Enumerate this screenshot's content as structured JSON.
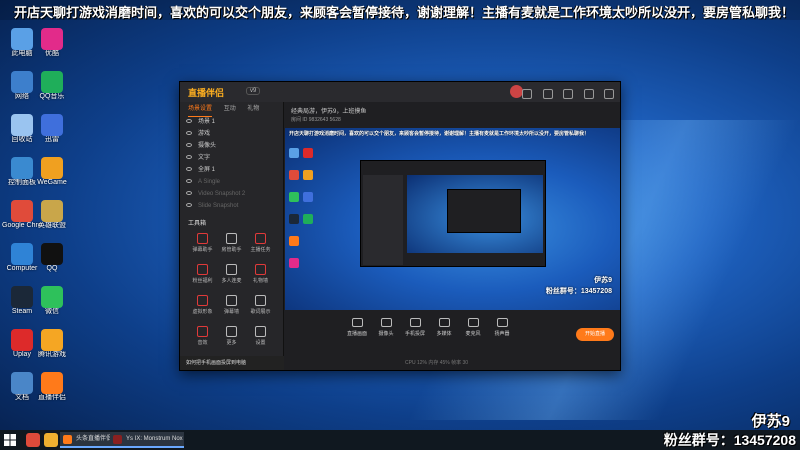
{
  "marquee": "开店天聊打游戏消磨时间，喜欢的可以交个朋友，来顾客会暂停接待，谢谢理解！主播有麦就是工作环境太吵所以没开，要房管私聊我！",
  "desktop_icons": [
    {
      "label": "此电脑",
      "color": "#5aa0e6"
    },
    {
      "label": "网络",
      "color": "#3d7fcc"
    },
    {
      "label": "回收站",
      "color": "#9ac4f0"
    },
    {
      "label": "控制面板",
      "color": "#3a8ad0"
    },
    {
      "label": "Google Chrome",
      "color": "#e04b3a"
    },
    {
      "label": "Computer",
      "color": "#2f83d6"
    },
    {
      "label": "Steam",
      "color": "#1b2838"
    },
    {
      "label": "Uplay",
      "color": "#dd2a2a"
    },
    {
      "label": "文档",
      "color": "#4a86c8"
    },
    {
      "label": "优酷",
      "color": "#e22b8a"
    },
    {
      "label": "QQ音乐",
      "color": "#1fae5a"
    },
    {
      "label": "迅雷",
      "color": "#3f6fdc"
    },
    {
      "label": "WeGame",
      "color": "#f0a020"
    },
    {
      "label": "英雄联盟",
      "color": "#c9a64a"
    },
    {
      "label": "QQ",
      "color": "#111111"
    },
    {
      "label": "微信",
      "color": "#2ec15b"
    },
    {
      "label": "腾讯游戏",
      "color": "#f5a623"
    },
    {
      "label": "直播伴侣",
      "color": "#ff7a1a"
    }
  ],
  "window": {
    "app_name": "直播伴侣",
    "version_badge": "v9",
    "left_tabs": [
      "场景设置",
      "互动",
      "礼物"
    ],
    "scenes": [
      {
        "name": "场景 1",
        "dim": false
      },
      {
        "name": "游戏",
        "dim": false
      },
      {
        "name": "摄像头",
        "dim": false
      },
      {
        "name": "文字",
        "dim": false
      },
      {
        "name": "全屏 1",
        "dim": false
      },
      {
        "name": "A Single",
        "dim": true
      },
      {
        "name": "Video Snapshot 2",
        "dim": true
      },
      {
        "name": "Slide Snapshot",
        "dim": true
      }
    ],
    "tools_title": "工具箱",
    "tools": [
      {
        "label": "弹幕助手",
        "color": "#e03a3a"
      },
      {
        "label": "房管助手",
        "color": "#bbbbbb"
      },
      {
        "label": "主播任务",
        "color": "#e03a3a"
      },
      {
        "label": "粉丝福利",
        "color": "#e03a3a"
      },
      {
        "label": "多人连麦",
        "color": "#bbbbbb"
      },
      {
        "label": "礼物墙",
        "color": "#e03a3a"
      },
      {
        "label": "虚拟形象",
        "color": "#e03a3a"
      },
      {
        "label": "弹幕墙",
        "color": "#bbbbbb"
      },
      {
        "label": "歌词展示",
        "color": "#bbbbbb"
      },
      {
        "label": "音效",
        "color": "#e03a3a"
      },
      {
        "label": "更多",
        "color": "#bbbbbb"
      },
      {
        "label": "设置",
        "color": "#bbbbbb"
      }
    ],
    "footer_tip": "如何把手机画面投屏到电脑",
    "stream_info": "经典局游，伊苏9，上班摸鱼",
    "stream_sub": "房间 ID 9832643    5628",
    "stage_name": "伊苏9",
    "stage_fans": "粉丝群号：13457208",
    "controls": [
      "直播画面",
      "摄像头",
      "手机投屏",
      "多媒体",
      "麦克风",
      "扬声器"
    ],
    "start_button": "开始直播",
    "status_bar": "CPU 12%   内存 45%   帧率 30"
  },
  "overlay": {
    "name": "伊苏9",
    "fans_label": "粉丝群号：13457208"
  },
  "taskbar": {
    "apps": [
      "头条直播伴侣",
      "Ys IX: Monstrum Nox"
    ]
  }
}
